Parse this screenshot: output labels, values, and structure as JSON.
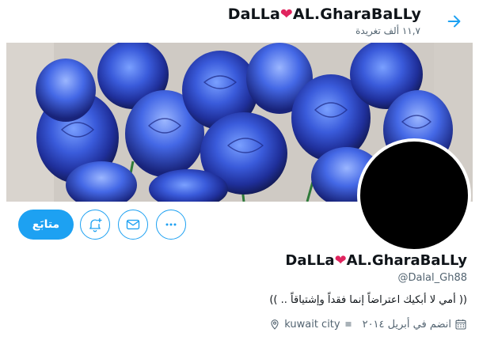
{
  "header": {
    "title_left": "DaLLa",
    "title_heart": "❤",
    "title_right": "AL.GharaBaLLy",
    "tweet_count": "١١,٧ ألف تغريدة",
    "back_icon": "arrow-right-icon"
  },
  "profile": {
    "name_left": "DaLLa",
    "name_heart": "❤",
    "name_right": "AL.GharaBaLLy",
    "handle": "@Dalal_Gh88",
    "bio": "(( أمي لا أبكيك اعتراضاً إنما فقداً وإشتياقاً .. ))",
    "location": "kuwait city",
    "joined": "انضم في أبريل ٢٠١٤"
  },
  "actions": {
    "follow_label": "متابَع",
    "notify_icon": "bell-plus-icon",
    "message_icon": "envelope-icon",
    "more_icon": "more-horizontal-icon"
  },
  "colors": {
    "accent": "#1da1f2",
    "heart": "#e0245e",
    "muted": "#536471"
  }
}
